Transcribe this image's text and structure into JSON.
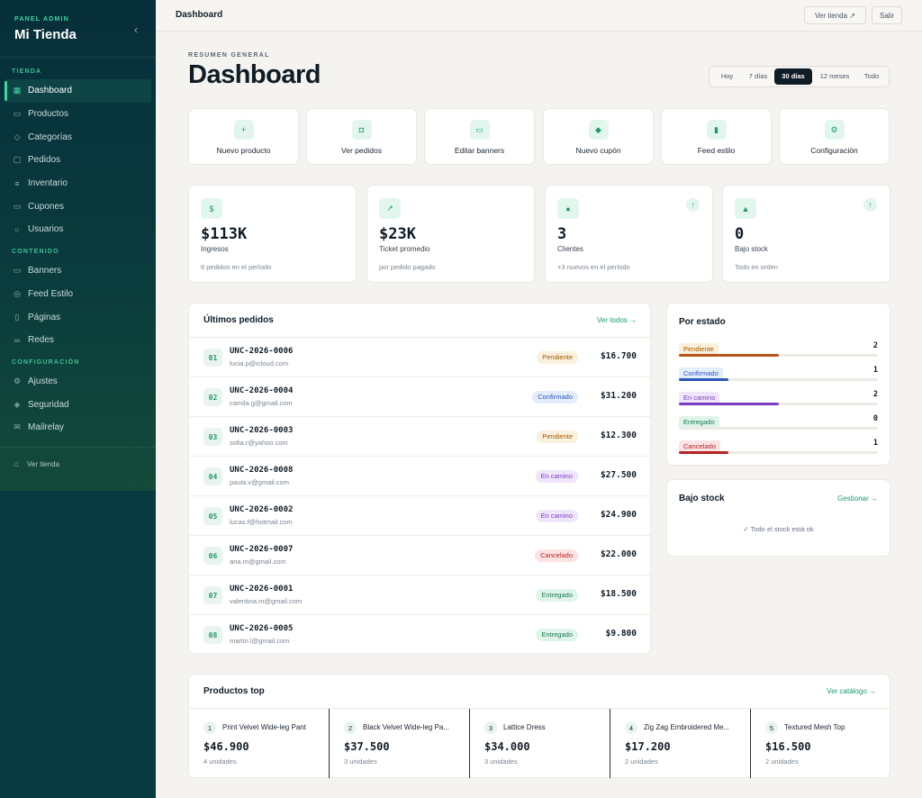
{
  "sidebar": {
    "kicker": "PANEL ADMIN",
    "brand": "Mi Tienda",
    "collapse_icon": "‹",
    "sections": {
      "tienda": "TIENDA",
      "contenido": "CONTENIDO",
      "configuracion": "CONFIGURACIÓN"
    },
    "items": [
      {
        "label": "Dashboard",
        "icon": "grid-icon",
        "glyph": "▦",
        "active": true
      },
      {
        "label": "Productos",
        "icon": "box-icon",
        "glyph": "▭"
      },
      {
        "label": "Categorías",
        "icon": "tag-icon",
        "glyph": "◇"
      },
      {
        "label": "Pedidos",
        "icon": "bag-icon",
        "glyph": "▢"
      },
      {
        "label": "Inventario",
        "icon": "database-icon",
        "glyph": "≡"
      },
      {
        "label": "Cupones",
        "icon": "ticket-icon",
        "glyph": "▭"
      },
      {
        "label": "Usuarios",
        "icon": "user-icon",
        "glyph": "○"
      },
      {
        "label": "Banners",
        "icon": "image-icon",
        "glyph": "▭"
      },
      {
        "label": "Feed Estilo",
        "icon": "camera-icon",
        "glyph": "◎"
      },
      {
        "label": "Páginas",
        "icon": "file-icon",
        "glyph": "▯"
      },
      {
        "label": "Redes",
        "icon": "link-icon",
        "glyph": "∞"
      },
      {
        "label": "Ajustes",
        "icon": "gear-icon",
        "glyph": "⚙"
      },
      {
        "label": "Seguridad",
        "icon": "shield-icon",
        "glyph": "◈"
      },
      {
        "label": "Mailrelay",
        "icon": "mail-icon",
        "glyph": "✉"
      }
    ],
    "footer": {
      "label": "Ver tienda",
      "glyph": "⌂"
    }
  },
  "topbar": {
    "title": "Dashboard",
    "view_store": "Ver tienda",
    "view_store_icon": "↗",
    "logout": "Salir"
  },
  "header": {
    "kicker": "RESUMEN GENERAL",
    "title": "Dashboard",
    "ranges": [
      {
        "label": "Hoy"
      },
      {
        "label": "7 días"
      },
      {
        "label": "30 días",
        "active": true
      },
      {
        "label": "12 meses"
      },
      {
        "label": "Todo"
      }
    ]
  },
  "quick_actions": [
    {
      "label": "Nuevo producto",
      "glyph": "+"
    },
    {
      "label": "Ver pedidos",
      "glyph": "◘"
    },
    {
      "label": "Editar banners",
      "glyph": "▭"
    },
    {
      "label": "Nuevo cupón",
      "glyph": "◆"
    },
    {
      "label": "Feed estilo",
      "glyph": "▮"
    },
    {
      "label": "Configuración",
      "glyph": "⚙"
    }
  ],
  "stats": [
    {
      "value": "$113K",
      "label": "Ingresos",
      "sub": "6 pedidos en el período",
      "glyph": "$",
      "trend": ""
    },
    {
      "value": "$23K",
      "label": "Ticket promedio",
      "sub": "por pedido pagado",
      "glyph": "↗",
      "trend": ""
    },
    {
      "value": "3",
      "label": "Clientes",
      "sub": "+3 nuevos en el período",
      "glyph": "●",
      "trend": "↑"
    },
    {
      "value": "0",
      "label": "Bajo stock",
      "sub": "Todo en orden",
      "glyph": "▲",
      "trend": "↑"
    }
  ],
  "orders": {
    "title": "Últimos pedidos",
    "link": "Ver todos →",
    "rows": [
      {
        "num": "01",
        "code": "UNC-2026-0006",
        "email": "lucia.p@icloud.com",
        "status": "Pendiente",
        "status_key": "pendiente",
        "amount": "$16.700"
      },
      {
        "num": "02",
        "code": "UNC-2026-0004",
        "email": "camila.g@gmail.com",
        "status": "Confirmado",
        "status_key": "confirmado",
        "amount": "$31.200"
      },
      {
        "num": "03",
        "code": "UNC-2026-0003",
        "email": "sofia.r@yahoo.com",
        "status": "Pendiente",
        "status_key": "pendiente",
        "amount": "$12.300"
      },
      {
        "num": "04",
        "code": "UNC-2026-0008",
        "email": "paula.v@gmail.com",
        "status": "En camino",
        "status_key": "encamino",
        "amount": "$27.500"
      },
      {
        "num": "05",
        "code": "UNC-2026-0002",
        "email": "lucas.f@hotmail.com",
        "status": "En camino",
        "status_key": "encamino",
        "amount": "$24.900"
      },
      {
        "num": "06",
        "code": "UNC-2026-0007",
        "email": "ana.m@gmail.com",
        "status": "Cancelado",
        "status_key": "cancelado",
        "amount": "$22.000"
      },
      {
        "num": "07",
        "code": "UNC-2026-0001",
        "email": "valentina.m@gmail.com",
        "status": "Entregado",
        "status_key": "entregado",
        "amount": "$18.500"
      },
      {
        "num": "08",
        "code": "UNC-2026-0005",
        "email": "martin.l@gmail.com",
        "status": "Entregado",
        "status_key": "entregado",
        "amount": "$9.800"
      }
    ]
  },
  "by_status": {
    "title": "Por estado",
    "rows": [
      {
        "label": "Pendiente",
        "key": "pendiente",
        "count": "2",
        "fraction": 0.5,
        "color": "#b8561a"
      },
      {
        "label": "Confirmado",
        "key": "confirmado",
        "count": "1",
        "fraction": 0.25,
        "color": "#2c56b8"
      },
      {
        "label": "En camino",
        "key": "encamino",
        "count": "2",
        "fraction": 0.5,
        "color": "#7a3cc2"
      },
      {
        "label": "Entregado",
        "key": "entregado",
        "count": "0",
        "fraction": 0,
        "color": "#187a4e"
      },
      {
        "label": "Cancelado",
        "key": "cancelado",
        "count": "1",
        "fraction": 0.25,
        "color": "#b52424"
      }
    ]
  },
  "low_stock": {
    "title": "Bajo stock",
    "link": "Gestionar →",
    "message": "✓ Todo el stock está ok"
  },
  "top_products": {
    "title": "Productos top",
    "link": "Ver catálogo →",
    "items": [
      {
        "rank": "1",
        "name": "Print Velvet Wide-leg Pant",
        "price": "$46.900",
        "units": "4 unidades"
      },
      {
        "rank": "2",
        "name": "Black Velvet Wide-leg Pa...",
        "price": "$37.500",
        "units": "3 unidades"
      },
      {
        "rank": "3",
        "name": "Lattice Dress",
        "price": "$34.000",
        "units": "3 unidades"
      },
      {
        "rank": "4",
        "name": "Zig Zag Embroidered Me...",
        "price": "$17.200",
        "units": "2 unidades"
      },
      {
        "rank": "5",
        "name": "Textured Mesh Top",
        "price": "$16.500",
        "units": "2 unidades"
      }
    ]
  },
  "colors": {
    "sidebar_bg": "#083a3f",
    "accent": "#3fd6a0",
    "accent_dark": "#1f9a6c",
    "page_bg": "#f4f3f0"
  }
}
